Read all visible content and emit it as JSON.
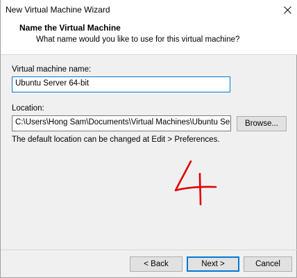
{
  "window": {
    "title": "New Virtual Machine Wizard"
  },
  "header": {
    "title": "Name the Virtual Machine",
    "subtitle": "What name would you like to use for this virtual machine?"
  },
  "form": {
    "name_label": "Virtual machine name:",
    "name_value": "Ubuntu Server 64-bit",
    "location_label": "Location:",
    "location_value": "C:\\Users\\Hong Sam\\Documents\\Virtual Machines\\Ubuntu Server",
    "browse_label": "Browse...",
    "hint": "The default location can be changed at Edit > Preferences."
  },
  "footer": {
    "back_label": "< Back",
    "next_label": "Next >",
    "cancel_label": "Cancel"
  },
  "annotation": {
    "text": "4",
    "color": "#e00000"
  },
  "icons": {
    "close": "close-icon"
  }
}
